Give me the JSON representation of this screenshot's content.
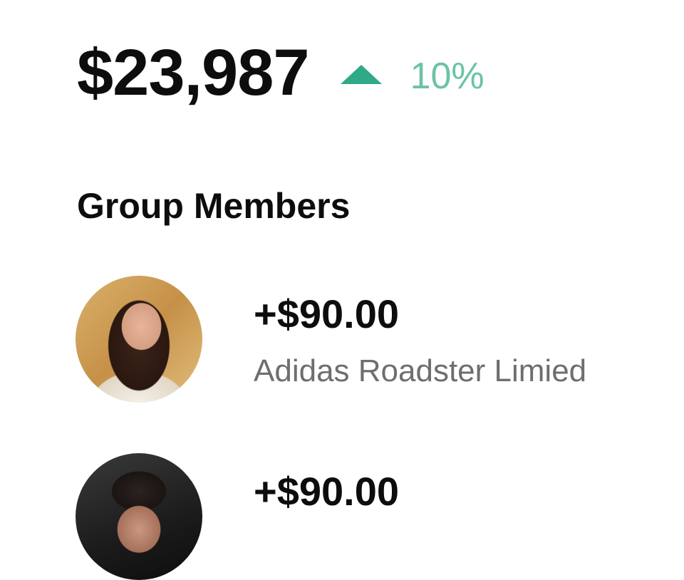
{
  "summary": {
    "balance": "$23,987",
    "trend_direction_icon": "triangle-up-icon",
    "trend_percent": "10%",
    "trend_color": "#2fa987",
    "trend_text_color": "#6cc3a6"
  },
  "group": {
    "title": "Group Members",
    "members": [
      {
        "amount": "+$90.00",
        "name": "Adidas Roadster Limied",
        "avatar": "woman-portrait"
      },
      {
        "amount": "+$90.00",
        "name": "",
        "avatar": "man-portrait"
      }
    ]
  }
}
